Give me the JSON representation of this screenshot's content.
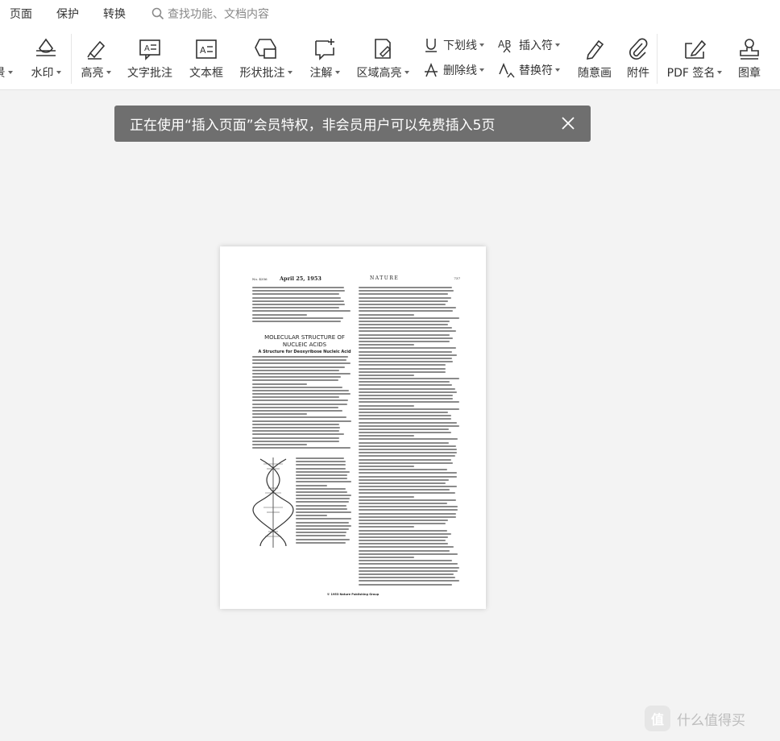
{
  "menu": {
    "items": [
      "页面",
      "保护",
      "转换"
    ],
    "search_placeholder": "查找功能、文档内容"
  },
  "ribbon": {
    "partial_label": "景",
    "watermark": "水印",
    "highlight": "高亮",
    "text_comment": "文字批注",
    "text_box": "文本框",
    "shape_comment": "形状批注",
    "annotation": "注解",
    "area_highlight": "区域高亮",
    "underline": "下划线",
    "insert_char": "插入符",
    "strikethrough": "删除线",
    "replace_char": "替换符",
    "freehand": "随意画",
    "attachment": "附件",
    "pdf_sign": "PDF 签名",
    "stamp": "图章"
  },
  "banner": {
    "text": "正在使用“插入页面”会员特权，非会员用户可以免费插入5页"
  },
  "document": {
    "issue_no": "No. 4356",
    "date": "April 25, 1953",
    "magazine": "NATURE",
    "page_number": "737",
    "title_line1": "MOLECULAR STRUCTURE OF",
    "title_line2": "NUCLEIC ACIDS",
    "subtitle": "A Structure for Deoxyribose Nucleic Acid",
    "footer": "© 1953 Nature Publishing Group"
  },
  "watermark_site": {
    "badge": "值",
    "text": "什么值得买"
  },
  "colors": {
    "banner_bg": "#6f6f6f",
    "workspace_bg": "#f3f3f3"
  }
}
